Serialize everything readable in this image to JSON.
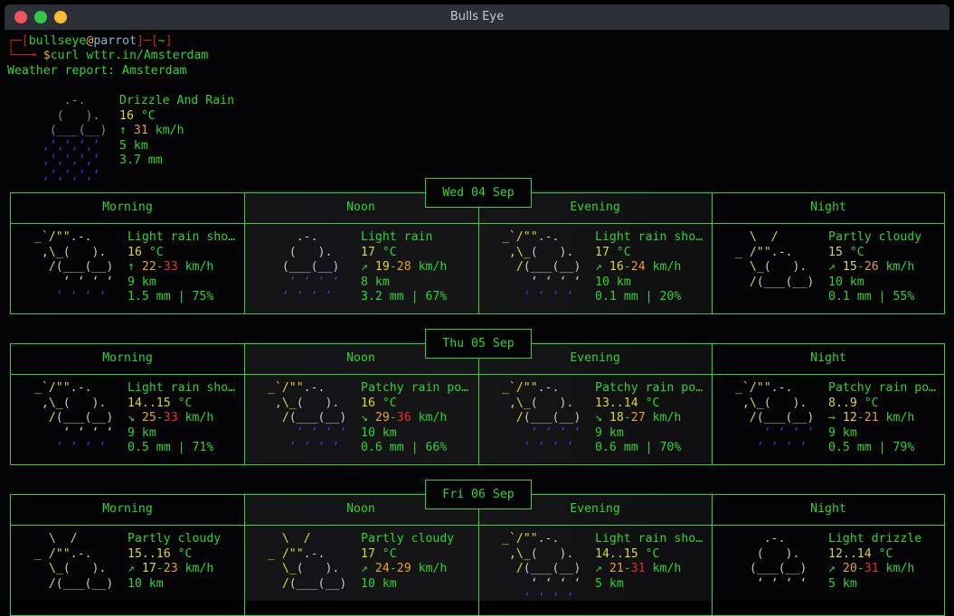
{
  "window": {
    "title": "Bulls Eye"
  },
  "prompt": {
    "user": "bullseye",
    "at": "@",
    "host": "parrot",
    "dir": "~",
    "symbol": "$",
    "command": "curl wttr.in/Amsterdam"
  },
  "report_title": "Weather report: Amsterdam",
  "current": {
    "condition": "Drizzle And Rain",
    "temp": "16",
    "temp_unit": "°C",
    "wind_arrow": "↑",
    "wind": "31",
    "wind_unit": "km/h",
    "visibility": "5 km",
    "precip": "3.7 mm",
    "icon": "drizzle-rain-icon"
  },
  "days": [
    {
      "date": "Wed 04 Sep",
      "periods": [
        {
          "name": "Morning",
          "icon": "light-rain-shower-icon",
          "condition": "Light rain sho…",
          "temp": "16",
          "wind_arrow": "↑",
          "wind_lo": "22",
          "wind_hi": "33",
          "visibility": "9 km",
          "precip": "1.5 mm | 75%"
        },
        {
          "name": "Noon",
          "icon": "light-rain-icon",
          "condition": "Light rain",
          "temp": "17",
          "wind_arrow": "↗",
          "wind_lo": "19",
          "wind_hi": "28",
          "visibility": "8 km",
          "precip": "3.2 mm | 67%"
        },
        {
          "name": "Evening",
          "icon": "light-rain-shower-icon",
          "condition": "Light rain sho…",
          "temp": "17",
          "wind_arrow": "↗",
          "wind_lo": "16",
          "wind_hi": "24",
          "visibility": "10 km",
          "precip": "0.1 mm | 20%"
        },
        {
          "name": "Night",
          "icon": "partly-cloudy-icon",
          "condition": "Partly cloudy",
          "temp": "15",
          "wind_arrow": "↗",
          "wind_lo": "15",
          "wind_hi": "26",
          "visibility": "10 km",
          "precip": "0.1 mm | 55%"
        }
      ]
    },
    {
      "date": "Thu 05 Sep",
      "periods": [
        {
          "name": "Morning",
          "icon": "light-rain-shower-icon",
          "condition": "Light rain sho…",
          "temp": "14..15",
          "wind_arrow": "↘",
          "wind_lo": "25",
          "wind_hi": "33",
          "visibility": "9 km",
          "precip": "0.5 mm | 71%"
        },
        {
          "name": "Noon",
          "icon": "patchy-rain-icon",
          "condition": "Patchy rain po…",
          "temp": "16",
          "wind_arrow": "↘",
          "wind_lo": "29",
          "wind_hi": "36",
          "visibility": "10 km",
          "precip": "0.6 mm | 66%"
        },
        {
          "name": "Evening",
          "icon": "patchy-rain-icon",
          "condition": "Patchy rain po…",
          "temp": "13..14",
          "wind_arrow": "↘",
          "wind_lo": "18",
          "wind_hi": "27",
          "visibility": "9 km",
          "precip": "0.6 mm | 70%"
        },
        {
          "name": "Night",
          "icon": "patchy-rain-icon",
          "condition": "Patchy rain po…",
          "temp": "8..9",
          "wind_arrow": "→",
          "wind_lo": "12",
          "wind_hi": "21",
          "visibility": "9 km",
          "precip": "0.5 mm | 79%"
        }
      ]
    },
    {
      "date": "Fri 06 Sep",
      "periods": [
        {
          "name": "Morning",
          "icon": "partly-cloudy-icon",
          "condition": "Partly cloudy",
          "temp": "15..16",
          "wind_arrow": "↗",
          "wind_lo": "17",
          "wind_hi": "23",
          "visibility": "10 km",
          "precip": ""
        },
        {
          "name": "Noon",
          "icon": "partly-cloudy-icon",
          "condition": "Partly cloudy",
          "temp": "17",
          "wind_arrow": "↗",
          "wind_lo": "24",
          "wind_hi": "29",
          "visibility": "10 km",
          "precip": ""
        },
        {
          "name": "Evening",
          "icon": "light-rain-shower-icon",
          "condition": "Light rain sho…",
          "temp": "14..15",
          "wind_arrow": "↗",
          "wind_lo": "21",
          "wind_hi": "31",
          "visibility": "5 km",
          "precip": ""
        },
        {
          "name": "Night",
          "icon": "light-drizzle-icon",
          "condition": "Light drizzle",
          "temp": "12..14",
          "wind_arrow": "↗",
          "wind_lo": "20",
          "wind_hi": "31",
          "visibility": "5 km",
          "precip": ""
        }
      ]
    }
  ]
}
